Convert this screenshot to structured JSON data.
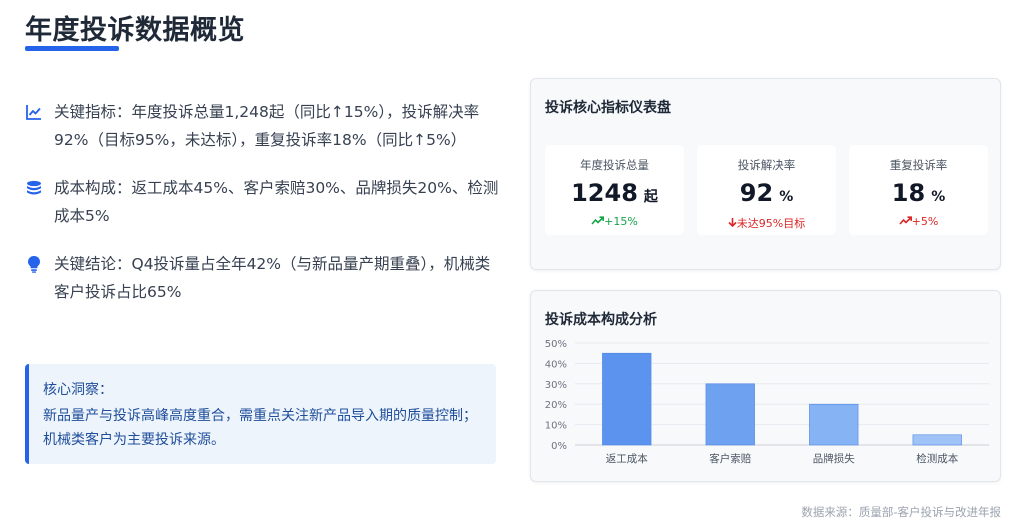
{
  "page": {
    "title": "年度投诉数据概览",
    "source": "数据来源：质量部-客户投诉与改进年报"
  },
  "bullets": [
    {
      "icon": "line-chart-icon",
      "text": "关键指标：年度投诉总量1,248起（同比↑15%），投诉解决率92%（目标95%，未达标），重复投诉率18%（同比↑5%）"
    },
    {
      "icon": "coins-icon",
      "text": "成本构成：返工成本45%、客户索赔30%、品牌损失20%、检测成本5%"
    },
    {
      "icon": "lightbulb-icon",
      "text": "关键结论：Q4投诉量占全年42%（与新品量产期重叠），机械类客户投诉占比65%"
    }
  ],
  "insight": {
    "title": "核心洞察：",
    "body": "新品量产与投诉高峰高度重合，需重点关注新产品导入期的质量控制；机械类客户为主要投诉来源。"
  },
  "dashboard": {
    "title": "投诉核心指标仪表盘",
    "metrics": [
      {
        "label": "年度投诉总量",
        "value": "1248",
        "unit": "起",
        "trend": "+15%",
        "trend_icon": "trend-up-icon",
        "trend_color": "#16a34a"
      },
      {
        "label": "投诉解决率",
        "value": "92",
        "unit": "%",
        "trend": "未达95%目标",
        "trend_icon": "arrow-down-icon",
        "trend_color": "#dc2626"
      },
      {
        "label": "重复投诉率",
        "value": "18",
        "unit": "%",
        "trend": "+5%",
        "trend_icon": "trend-up-icon",
        "trend_color": "#dc2626"
      }
    ]
  },
  "chart_title": "投诉成本构成分析",
  "chart_data": {
    "type": "bar",
    "title": "投诉成本构成分析",
    "categories": [
      "返工成本",
      "客户索赔",
      "品牌损失",
      "检测成本"
    ],
    "values": [
      45,
      30,
      20,
      5
    ],
    "ylim": [
      0,
      50
    ],
    "yticks": [
      "0%",
      "10%",
      "20%",
      "30%",
      "40%",
      "50%"
    ],
    "grid": true,
    "colors": [
      "#5b93ee",
      "#6ea2f1",
      "#86b3f4",
      "#9fc3f7"
    ]
  }
}
